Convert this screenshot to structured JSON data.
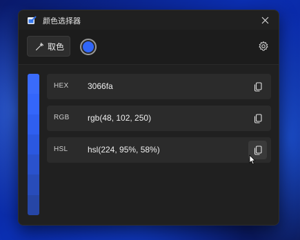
{
  "window": {
    "title": "颜色选择器",
    "close_icon": "close-icon",
    "app_icon": "color-picker-app-icon"
  },
  "toolbar": {
    "pick_label": "取色",
    "pick_icon": "eyedropper-icon",
    "current_color": "#3066fa",
    "settings_icon": "gear-icon"
  },
  "palette": [
    "#3a6bfb",
    "#3466fa",
    "#2f5ff0",
    "#2b58e0",
    "#2a52cd",
    "#284cba",
    "#2646a6"
  ],
  "rows": [
    {
      "label": "HEX",
      "value": "3066fa"
    },
    {
      "label": "RGB",
      "value": "rgb(48, 102, 250)"
    },
    {
      "label": "HSL",
      "value": "hsl(224, 95%, 58%)"
    }
  ]
}
